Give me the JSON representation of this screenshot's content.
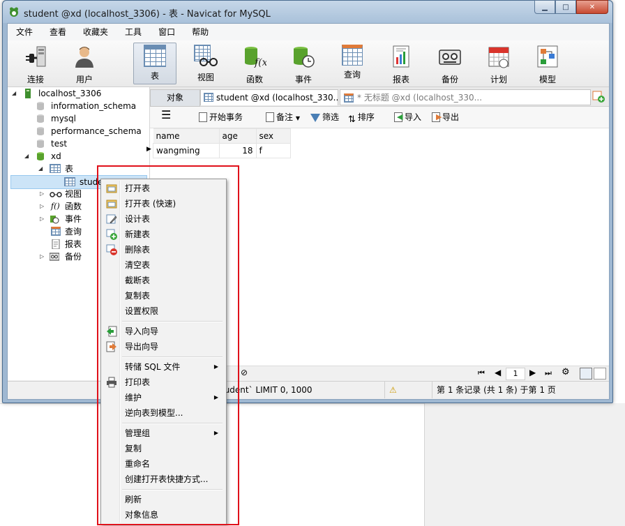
{
  "window": {
    "title": "student @xd (localhost_3306) - 表 - Navicat for MySQL",
    "controls": {
      "minimize": "▁",
      "maximize": "□",
      "close": "✕"
    }
  },
  "menubar": [
    "文件",
    "查看",
    "收藏夹",
    "工具",
    "窗口",
    "帮助"
  ],
  "toolbar": [
    {
      "label": "连接",
      "icon": "plug-icon"
    },
    {
      "label": "用户",
      "icon": "user-icon"
    },
    {
      "label": "表",
      "icon": "table-icon",
      "active": true
    },
    {
      "label": "视图",
      "icon": "view-icon"
    },
    {
      "label": "函数",
      "icon": "function-icon"
    },
    {
      "label": "事件",
      "icon": "event-icon"
    },
    {
      "label": "查询",
      "icon": "query-icon"
    },
    {
      "label": "报表",
      "icon": "report-icon"
    },
    {
      "label": "备份",
      "icon": "backup-icon"
    },
    {
      "label": "计划",
      "icon": "schedule-icon"
    },
    {
      "label": "模型",
      "icon": "model-icon"
    }
  ],
  "tree": {
    "connection": "localhost_3306",
    "databases": [
      "information_schema",
      "mysql",
      "performance_schema",
      "test",
      "xd"
    ],
    "xd_children": [
      "表",
      "视图",
      "函数",
      "事件",
      "查询",
      "报表",
      "备份"
    ],
    "selected_table": "student"
  },
  "tabs": {
    "objects": "对象",
    "student": "student @xd (localhost_330...",
    "untitled": "* 无标题 @xd (localhost_330..."
  },
  "grid_toolbar": {
    "begin_transaction": "开始事务",
    "note": "备注",
    "filter": "筛选",
    "sort": "排序",
    "import": "导入",
    "export": "导出"
  },
  "grid": {
    "columns": [
      "name",
      "age",
      "sex"
    ],
    "rows": [
      [
        "wangming",
        "18",
        "f"
      ]
    ]
  },
  "grid_nav": {
    "page": "1"
  },
  "status": {
    "sql": "tudent` LIMIT 0, 1000",
    "records": "第 1 条记录 (共 1 条) 于第 1 页"
  },
  "context_menu": {
    "items": [
      {
        "label": "打开表",
        "icon": "open-table-icon"
      },
      {
        "label": "打开表 (快速)",
        "icon": "open-table-fast-icon"
      },
      {
        "label": "设计表",
        "icon": "design-table-icon"
      },
      {
        "label": "新建表",
        "icon": "new-table-icon"
      },
      {
        "label": "删除表",
        "icon": "delete-table-icon"
      },
      {
        "label": "清空表"
      },
      {
        "label": "截断表"
      },
      {
        "label": "复制表"
      },
      {
        "label": "设置权限"
      },
      {
        "label": "导入向导",
        "icon": "import-wizard-icon"
      },
      {
        "label": "导出向导",
        "icon": "export-wizard-icon"
      },
      {
        "label": "转储 SQL 文件",
        "submenu": true
      },
      {
        "label": "打印表",
        "icon": "print-icon"
      },
      {
        "label": "维护",
        "submenu": true
      },
      {
        "label": "逆向表到模型..."
      },
      {
        "label": "管理组",
        "submenu": true
      },
      {
        "label": "复制"
      },
      {
        "label": "重命名"
      },
      {
        "label": "创建打开表快捷方式..."
      },
      {
        "label": "刷新"
      },
      {
        "label": "对象信息"
      }
    ]
  },
  "colors": {
    "highlight_box": "#e0101a",
    "selection": "#cce4f7",
    "title_bar": "#a9c1da"
  }
}
